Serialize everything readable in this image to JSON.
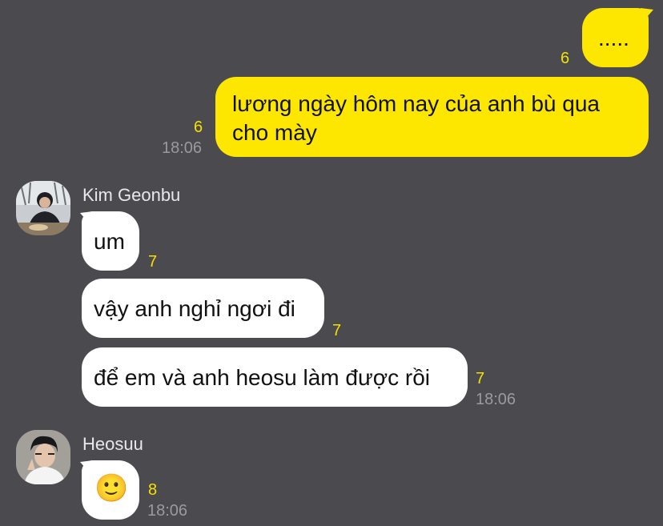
{
  "messages_outgoing": [
    {
      "text": ".....",
      "unread": "6"
    },
    {
      "text_line1": "lương ngày hôm nay của anh bù qua",
      "text_line2": "cho mày",
      "unread": "6",
      "time": "18:06"
    }
  ],
  "sender1": {
    "name": "Kim Geonbu",
    "messages": [
      {
        "text": "um",
        "unread": "7"
      },
      {
        "text": "vậy anh nghỉ ngơi đi",
        "unread": "7"
      },
      {
        "text": "để em và anh heosu làm được rồi",
        "unread": "7",
        "time": "18:06"
      }
    ]
  },
  "sender2": {
    "name": "Heosuu",
    "messages": [
      {
        "emoji": "🙂",
        "unread": "8",
        "time": "18:06"
      }
    ]
  },
  "colors": {
    "background": "#4b4a4f",
    "my_bubble": "#fde600",
    "their_bubble": "#ffffff",
    "unread_count": "#f5e100",
    "timestamp": "#9b9a9e"
  }
}
